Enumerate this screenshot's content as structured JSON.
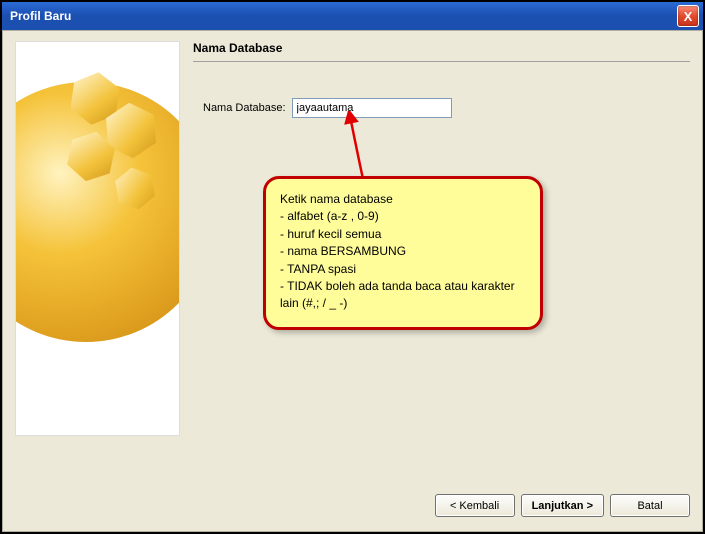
{
  "window": {
    "title": "Profil Baru",
    "close_symbol": "X"
  },
  "page": {
    "heading": "Nama Database"
  },
  "form": {
    "db_label": "Nama Database:",
    "db_value": "jayaautama"
  },
  "callout": {
    "title": "Ketik nama database",
    "rules": [
      "- alfabet (a-z , 0-9)",
      "- huruf kecil semua",
      "- nama BERSAMBUNG",
      "- TANPA spasi",
      "- TIDAK boleh ada tanda baca atau karakter lain (#,; / _ -)"
    ]
  },
  "buttons": {
    "back": "< Kembali",
    "next": "Lanjutkan >",
    "cancel": "Batal"
  }
}
